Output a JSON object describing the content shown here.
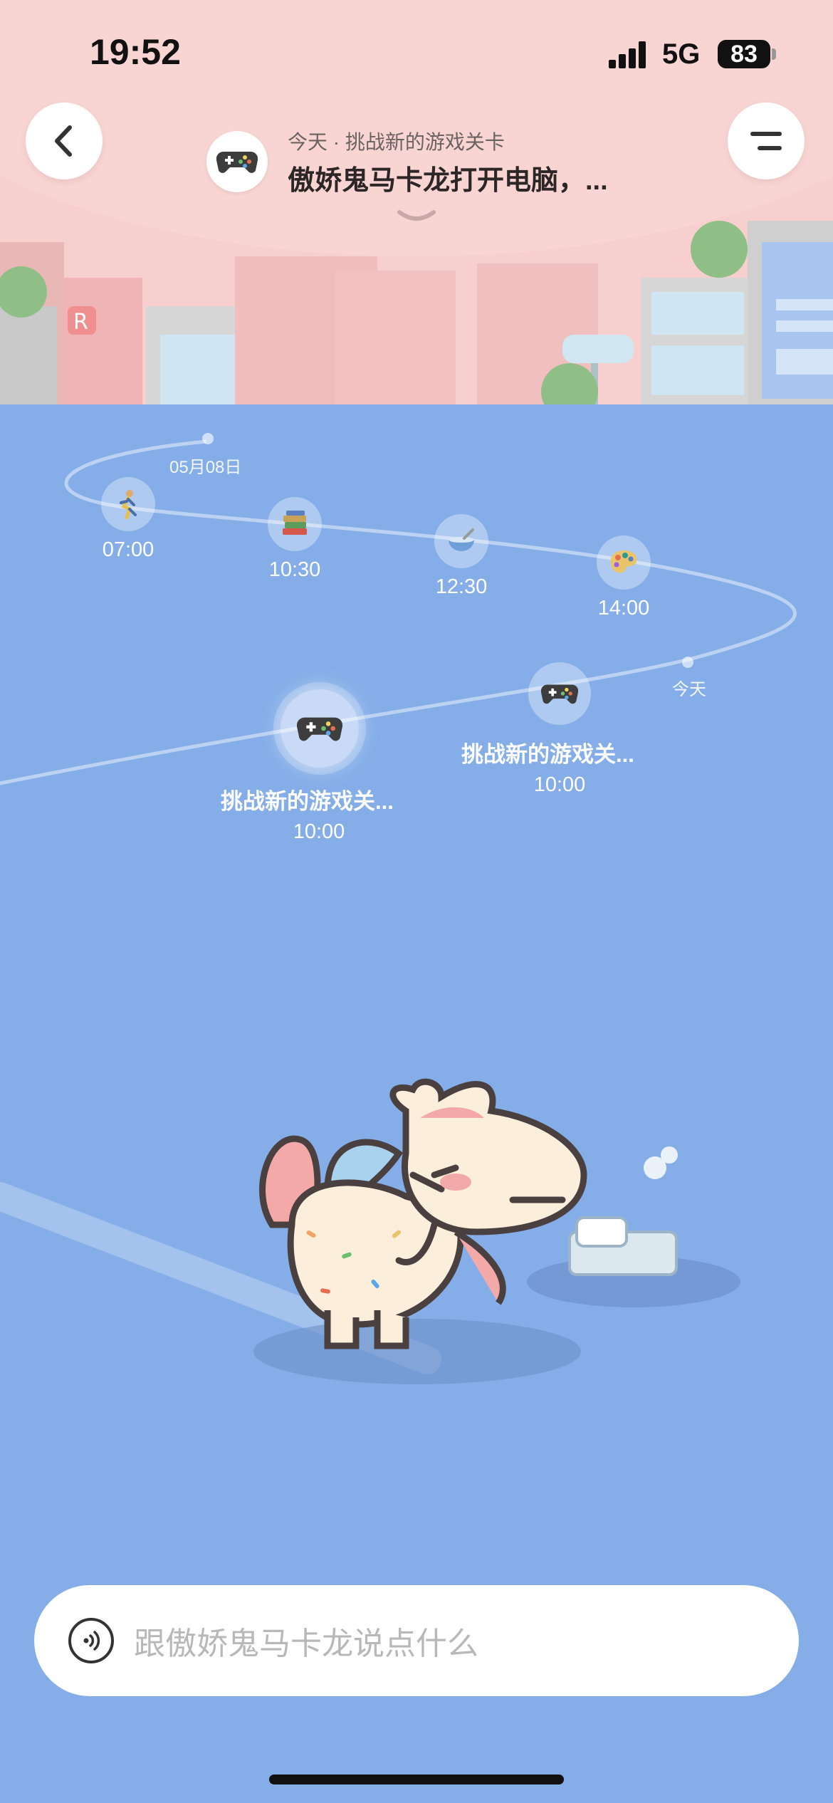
{
  "status_bar": {
    "time": "19:52",
    "network": "5G",
    "battery": "83"
  },
  "header": {
    "subtitle": "今天 · 挑战新的游戏关卡",
    "title": "傲娇鬼马卡龙打开电脑，...",
    "avatar_icon": "game-controller-icon"
  },
  "timeline": {
    "date_marker": "05月08日",
    "today_marker": "今天",
    "items": [
      {
        "time": "07:00",
        "icon": "running-person-icon"
      },
      {
        "time": "10:30",
        "icon": "books-icon"
      },
      {
        "time": "12:30",
        "icon": "bowl-icon"
      },
      {
        "time": "14:00",
        "icon": "palette-icon"
      },
      {
        "time": "10:00",
        "label": "挑战新的游戏关...",
        "icon": "game-controller-icon"
      },
      {
        "time": "10:00",
        "label": "挑战新的游戏关...",
        "icon": "game-controller-icon",
        "active": true
      }
    ]
  },
  "chat": {
    "placeholder": "跟傲娇鬼马卡龙说点什么"
  },
  "colors": {
    "sky_pink": "#f6cfce",
    "water_blue": "#85aee8",
    "text_dark": "#2d2626"
  }
}
